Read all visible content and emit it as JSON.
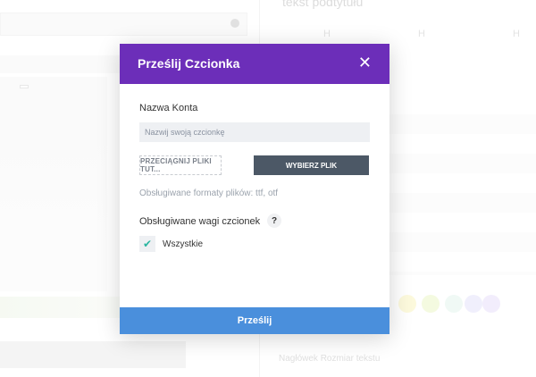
{
  "background": {
    "heading": "tekst podtytułu",
    "column_marks": [
      "H",
      "H",
      "H"
    ],
    "tag_label": "",
    "bottom_label": "Nagłówek Rozmiar tekstu",
    "swatch_colors": [
      "#fbf6c9",
      "#eef8cf",
      "#e8f6f0",
      "#e9e7fb",
      "#ece4fb"
    ]
  },
  "modal": {
    "title": "Prześlij Czcionka",
    "close_label": "✕",
    "name_label": "Nazwa Konta",
    "name_placeholder": "Nazwij swoją czcionkę",
    "drop_zone_label": "PRZECIĄGNIJ PLIKI TUT...",
    "choose_button": "WYBIERZ PLIK",
    "formats_text": "Obsługiwane formaty plików: ttf, otf",
    "weights_label": "Obsługiwane wagi czcionek",
    "help_icon": "?",
    "checkbox_label": "Wszystkie",
    "checkbox_checked": true,
    "submit_button": "Prześlij",
    "header_color": "#6c2eb9",
    "submit_color": "#4a8fdc"
  }
}
